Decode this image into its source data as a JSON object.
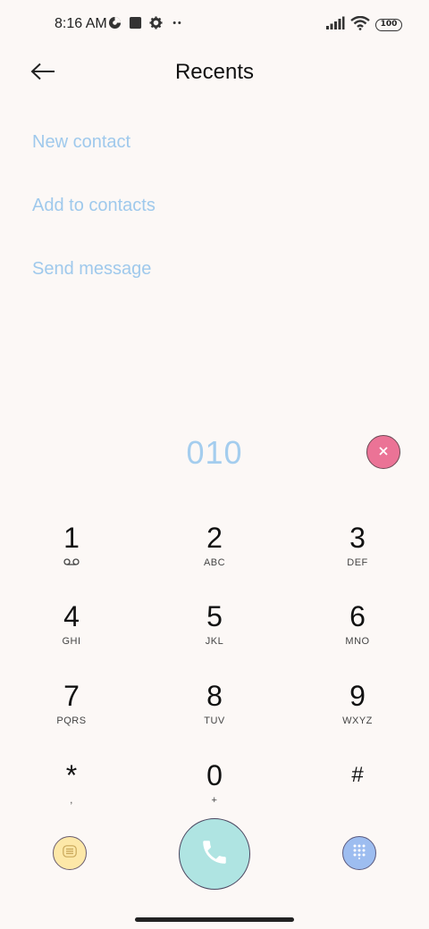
{
  "status_bar": {
    "time": "8:16 AM",
    "battery": "100",
    "icons": [
      "data-saver-icon",
      "square-icon",
      "settings-gear-icon",
      "more-dots-icon",
      "signal-icon",
      "wifi-icon",
      "battery-icon"
    ]
  },
  "header": {
    "title": "Recents",
    "back_icon": "arrow-left-icon"
  },
  "actions": [
    {
      "label": "New contact"
    },
    {
      "label": "Add to contacts"
    },
    {
      "label": "Send message"
    }
  ],
  "dialer": {
    "number": "010",
    "clear_icon": "close-icon"
  },
  "keypad": [
    {
      "digit": "1",
      "letters": ""
    },
    {
      "digit": "2",
      "letters": "ABC"
    },
    {
      "digit": "3",
      "letters": "DEF"
    },
    {
      "digit": "4",
      "letters": "GHI"
    },
    {
      "digit": "5",
      "letters": "JKL"
    },
    {
      "digit": "6",
      "letters": "MNO"
    },
    {
      "digit": "7",
      "letters": "PQRS"
    },
    {
      "digit": "8",
      "letters": "TUV"
    },
    {
      "digit": "9",
      "letters": "WXYZ"
    },
    {
      "digit": "*",
      "letters": ","
    },
    {
      "digit": "0",
      "letters": "+"
    },
    {
      "digit": "#",
      "letters": ""
    }
  ],
  "colors": {
    "background": "#fcf8f6",
    "accent_text": "#9fc9ec",
    "number": "#a4cdee",
    "clear": "#eb7396",
    "menu": "#fde8a8",
    "call": "#afe4e2",
    "dialpad": "#9dbdf0"
  }
}
